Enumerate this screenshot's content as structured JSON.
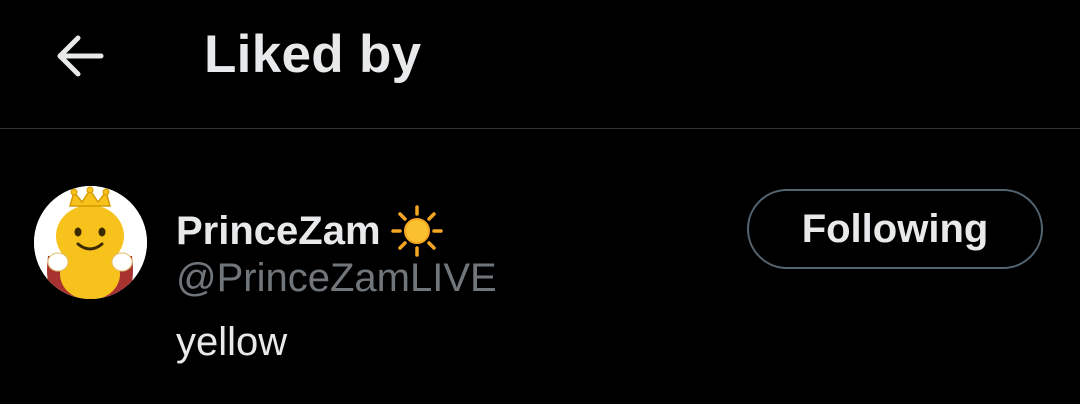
{
  "header": {
    "title": "Liked by",
    "back_icon": "arrow-left-icon"
  },
  "user": {
    "display_name": "PrinceZam",
    "name_emoji": "sun-icon",
    "handle": "@PrinceZamLIVE",
    "bio": "yellow",
    "avatar_icon": "avatar-crowned-character"
  },
  "follow_button": {
    "label": "Following"
  },
  "colors": {
    "background": "#000000",
    "text_primary": "#e7e9ea",
    "text_secondary": "#71767b",
    "divider": "#2f3336",
    "button_border": "#536471"
  }
}
